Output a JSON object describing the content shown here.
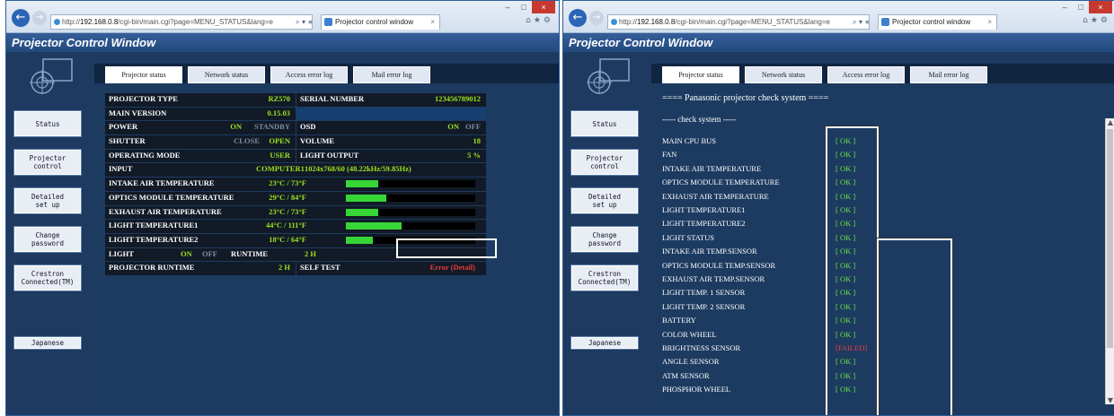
{
  "browser": {
    "url_prefix": "http://",
    "url_host": "192.168.0.8",
    "url_path": "/cgi-bin/main.cgi?page=MENU_STATUS&lang=e",
    "addr_tools": "⌕ ▾ ≡ ↻",
    "tab_title": "Projector control window",
    "tab_close": "×",
    "back": "←",
    "forward": "→",
    "minimize": "–",
    "maximize": "□",
    "close": "×",
    "icons": "⌂★⚙"
  },
  "page_title": "Projector Control Window",
  "tabs": [
    "Projector status",
    "Network status",
    "Access error log",
    "Mail error log"
  ],
  "sidebar": {
    "status": "Status",
    "projector_control": "Projector\ncontrol",
    "detailed_setup": "Detailed\nset up",
    "change_password": "Change\npassword",
    "crestron": "Crestron\nConnected(TM)",
    "japanese": "Japanese"
  },
  "status": {
    "projector_type_label": "PROJECTOR TYPE",
    "projector_type": "RZ570",
    "serial_label": "SERIAL NUMBER",
    "serial": "123456789012",
    "main_version_label": "MAIN VERSION",
    "main_version": "0.15.03",
    "power_label": "POWER",
    "power_on": "ON",
    "power_standby": "STANDBY",
    "osd_label": "OSD",
    "osd_on": "ON",
    "osd_off": "OFF",
    "shutter_label": "SHUTTER",
    "shutter_close": "CLOSE",
    "shutter_open": "OPEN",
    "volume_label": "VOLUME",
    "volume": "18",
    "mode_label": "OPERATING MODE",
    "mode": "USER",
    "light_output_label": "LIGHT OUTPUT",
    "light_output": "5 %",
    "input_label": "INPUT",
    "input": "COMPUTER1",
    "input_signal": "1024x768/60 (48.22kHz/59.85Hz)",
    "temps": [
      {
        "label": "INTAKE AIR TEMPERATURE",
        "value": "23°C / 73°F",
        "level": 0.25
      },
      {
        "label": "OPTICS MODULE TEMPERATURE",
        "value": "29°C / 84°F",
        "level": 0.31
      },
      {
        "label": "EXHAUST AIR TEMPERATURE",
        "value": "23°C / 73°F",
        "level": 0.25
      },
      {
        "label": "LIGHT TEMPERATURE1",
        "value": "44°C / 111°F",
        "level": 0.43
      },
      {
        "label": "LIGHT TEMPERATURE2",
        "value": "18°C / 64°F",
        "level": 0.21
      }
    ],
    "light_label": "LIGHT",
    "light_on": "ON",
    "light_off": "OFF",
    "runtime_label": "RUNTIME",
    "runtime": "2 H",
    "proj_runtime_label": "PROJECTOR RUNTIME",
    "proj_runtime": "2 H",
    "self_test_label": "SELF TEST",
    "self_test_value": "Error (Detail)"
  },
  "check": {
    "title": "==== Panasonic projector check system ====",
    "subtitle": "----- check system -----",
    "items": [
      {
        "name": "MAIN CPU BUS",
        "result": "[ OK ]"
      },
      {
        "name": "FAN",
        "result": "[ OK ]"
      },
      {
        "name": "INTAKE AIR TEMPERATURE",
        "result": "[ OK ]"
      },
      {
        "name": "OPTICS MODULE TEMPERATURE",
        "result": "[ OK ]"
      },
      {
        "name": "EXHAUST AIR TEMPERATURE",
        "result": "[ OK ]"
      },
      {
        "name": "LIGHT TEMPERATURE1",
        "result": "[ OK ]"
      },
      {
        "name": "LIGHT TEMPERATURE2",
        "result": "[ OK ]"
      },
      {
        "name": "LIGHT STATUS",
        "result": "[ OK ]"
      },
      {
        "name": "INTAKE AIR TEMP.SENSOR",
        "result": "[ OK ]"
      },
      {
        "name": "OPTICS MODULE TEMP.SENSOR",
        "result": "[ OK ]"
      },
      {
        "name": "EXHAUST AIR TEMP.SENSOR",
        "result": "[ OK ]"
      },
      {
        "name": "LIGHT TEMP. 1 SENSOR",
        "result": "[ OK ]"
      },
      {
        "name": "LIGHT TEMP. 2 SENSOR",
        "result": "[ OK ]"
      },
      {
        "name": "BATTERY",
        "result": "[ OK ]"
      },
      {
        "name": "COLOR WHEEL",
        "result": "[ OK ]"
      },
      {
        "name": "BRIGHTNESS SENSOR",
        "result": "[FAILED]"
      },
      {
        "name": "ANGLE SENSOR",
        "result": "[ OK ]"
      },
      {
        "name": "ATM SENSOR",
        "result": "[ OK ]"
      },
      {
        "name": "PHOSPHOR WHEEL",
        "result": "[ OK ]"
      }
    ]
  },
  "colors": {
    "ok": "#6be040",
    "failed": "#e04040",
    "value": "#9be020",
    "bar": "#37d637"
  }
}
